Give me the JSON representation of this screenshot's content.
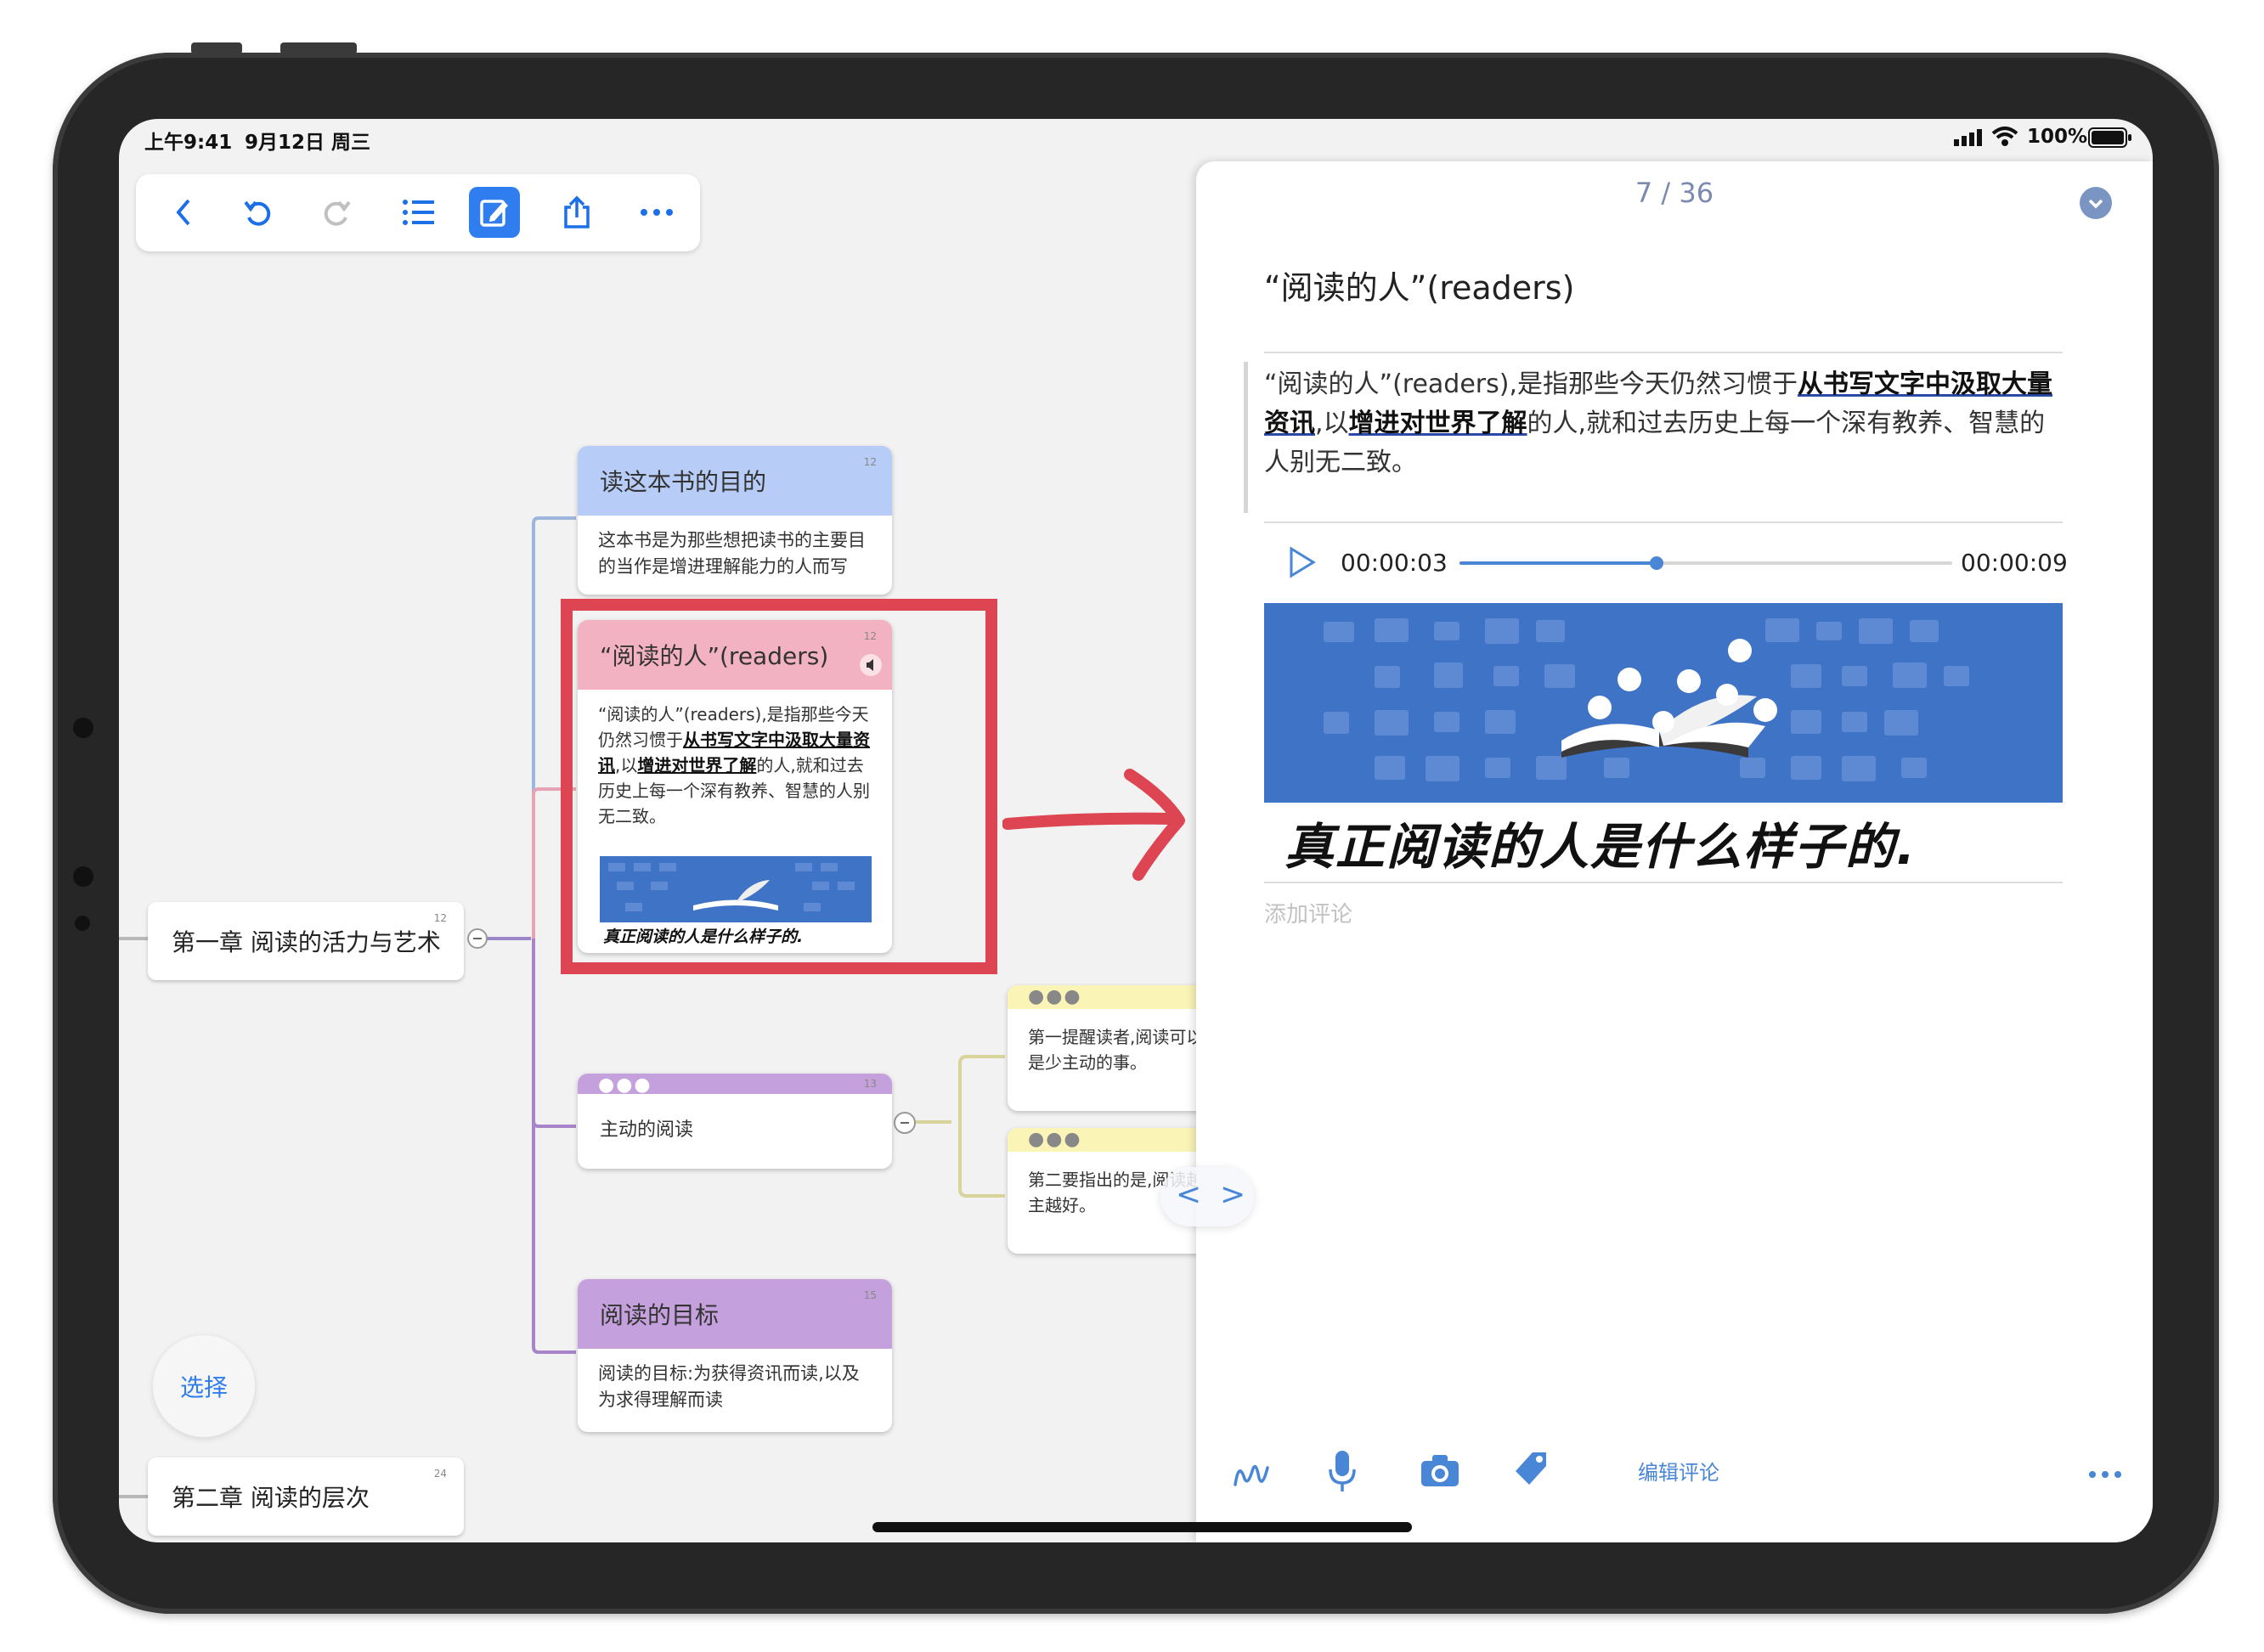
{
  "status_bar": {
    "time": "上午9:41",
    "date": "9月12日 周三",
    "battery": "100%"
  },
  "toolbar": {
    "icons": [
      "back-icon",
      "undo-icon",
      "redo-icon",
      "outline-list-icon",
      "edit-note-icon",
      "share-icon",
      "more-icon"
    ]
  },
  "mindmap": {
    "root1": {
      "label": "第一章 阅读的活力与艺术",
      "num": "12"
    },
    "root2": {
      "label": "第二章 阅读的层次",
      "num": "24"
    },
    "card_purpose": {
      "title": "读这本书的目的",
      "num": "12",
      "body": "这本书是为那些想把读书的主要目的当作是增进理解能力的人而写"
    },
    "card_readers": {
      "title": "“阅读的人”(readers)",
      "num": "12",
      "body_1": "“阅读的人”(readers),是指那些今天仍然习惯于",
      "body_u1": "从书写文字中汲取大量资讯",
      "body_2": ",以",
      "body_u2": "增进对世界了解",
      "body_3": "的人,就和过去历史上每一个深有教养、智慧的人别无二致。",
      "handwriting": "真正阅读的人是什么样子的."
    },
    "card_active": {
      "title": "主动的阅读",
      "num": "13"
    },
    "card_goal": {
      "title": "阅读的目标",
      "num": "15",
      "body": "阅读的目标:为获得资讯而读,以及为求得理解而读"
    },
    "card_y1": {
      "body": "第一提醒读者,阅读可以是少主动的事。"
    },
    "card_y2": {
      "body": "第二要指出的是,阅读越主越好。"
    },
    "select_button": "选择",
    "nav_prev": "<",
    "nav_next": ">"
  },
  "panel": {
    "page": "7 / 36",
    "title": "“阅读的人”(readers)",
    "text_1": "“阅读的人”(readers),是指那些今天仍然习惯于",
    "text_u1": "从书写文字中汲取大量资讯",
    "text_2": ",以",
    "text_u2": "增进对世界了解",
    "text_3": "的人,就和过去历史上每一个深有教养、智慧的人别无二致。",
    "audio_current": "00:00:03",
    "audio_total": "00:00:09",
    "audio_progress": 0.4,
    "handwriting": "真正阅读的人是什么样子的.",
    "comment_placeholder": "添加评论",
    "edit_comment": "编辑评论"
  },
  "colors": {
    "blue_card": "#b7cdf7",
    "pink_card": "#f2b2c1",
    "purple_card": "#c4a1dd",
    "yellow_card": "#faf5b7",
    "highlight_red": "#dd4553",
    "accent": "#2f7dee"
  }
}
